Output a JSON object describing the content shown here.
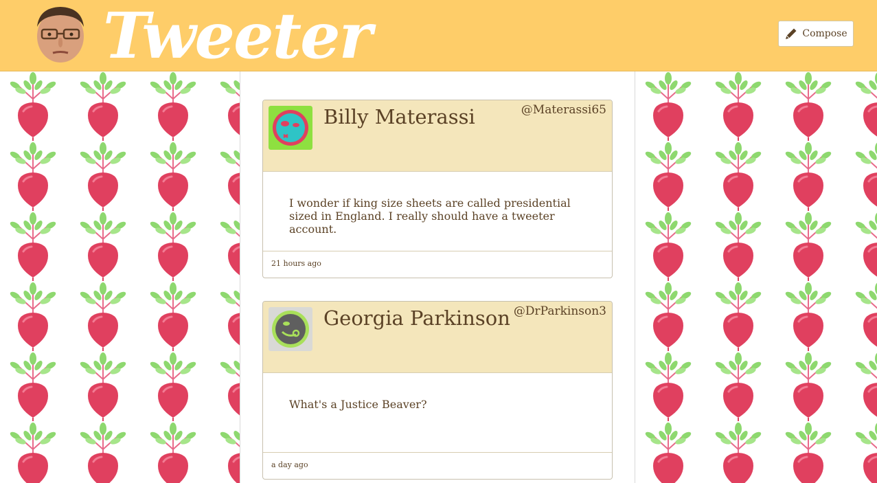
{
  "nav": {
    "brand": "Tweeter",
    "compose_label": "Compose"
  },
  "colors": {
    "nav_bg": "#fecd69",
    "tweet_header_bg": "#f4e6bb",
    "text": "#5b4226",
    "beet": "#e0405f",
    "leaf": "#8ed86f"
  },
  "tweets": [
    {
      "name": "Billy Materassi",
      "handle": "@Materassi65",
      "text": "I wonder if king size sheets are called presidential sized in England. I really should have a tweeter account.",
      "time": "21 hours ago",
      "avatar_icon": "alien-avatar-icon"
    },
    {
      "name": "Georgia Parkinson",
      "handle": "@DrParkinson3",
      "text": "What's a Justice Beaver?",
      "time": "a day ago",
      "avatar_icon": "alien-avatar-icon"
    }
  ]
}
